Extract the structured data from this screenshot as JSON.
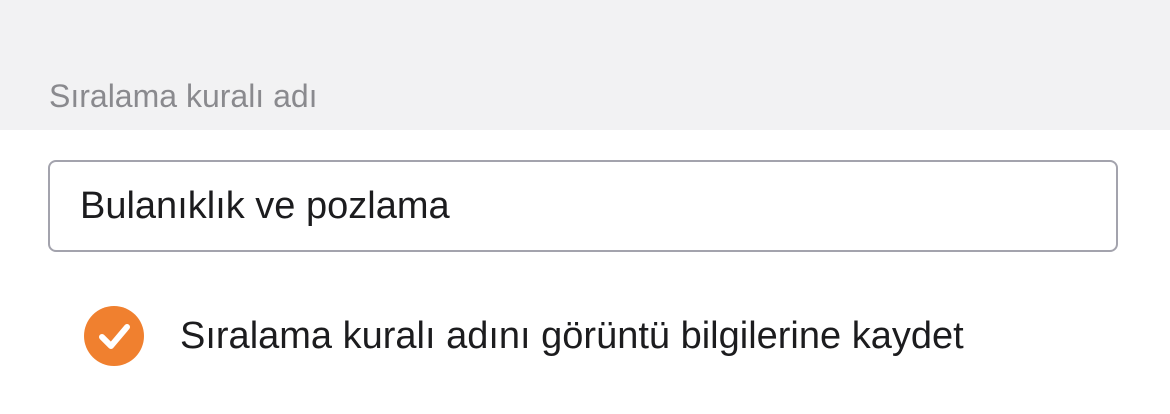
{
  "section": {
    "label": "Sıralama kuralı adı"
  },
  "name_field": {
    "value": "Bulanıklık ve pozlama"
  },
  "save_option": {
    "label": "Sıralama kuralı adını görüntü bilgilerine kaydet",
    "checked": true,
    "icon": "checkmark-icon",
    "accent_color": "#f0802f"
  }
}
